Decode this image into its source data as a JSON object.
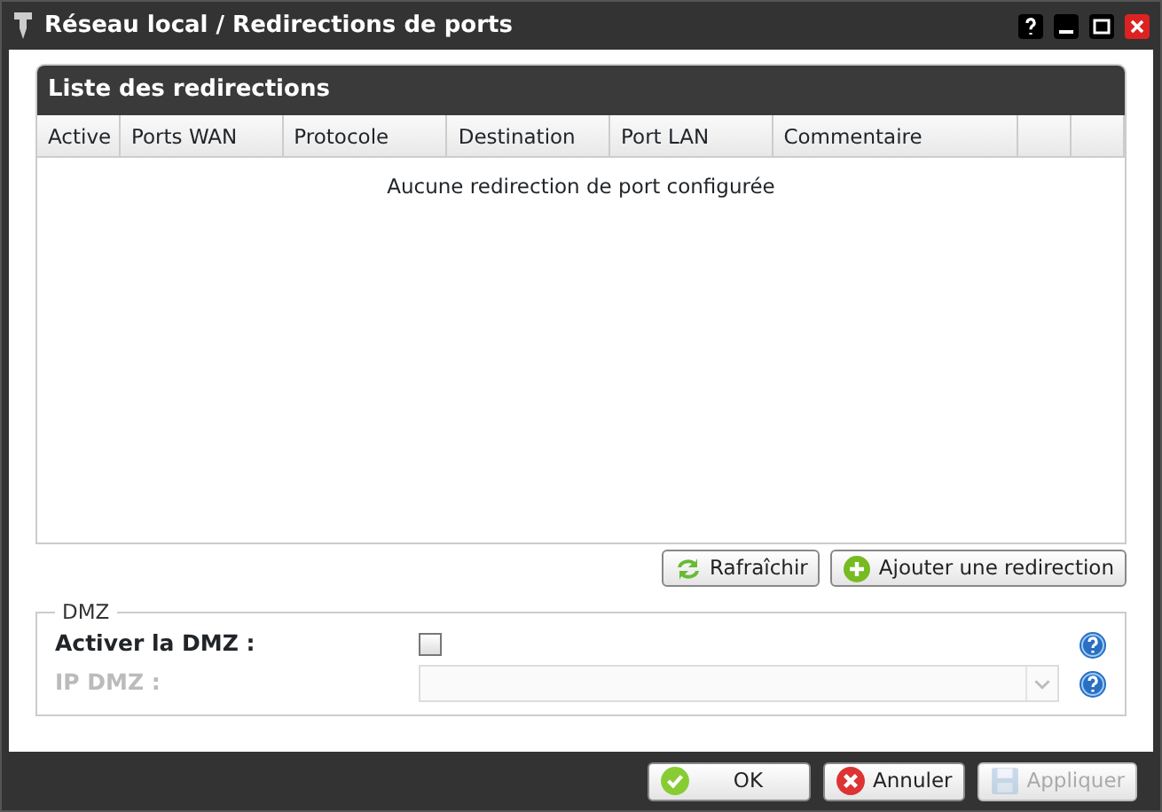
{
  "window": {
    "title": "Réseau local / Redirections de ports"
  },
  "panel": {
    "title": "Liste des redirections",
    "columns": [
      "Active",
      "Ports WAN",
      "Protocole",
      "Destination",
      "Port LAN",
      "Commentaire"
    ],
    "empty_message": "Aucune redirection de port configurée"
  },
  "panel_buttons": [
    {
      "kind": "refresh",
      "label": "Rafraîchir"
    },
    {
      "kind": "add",
      "label": "Ajouter une redirection"
    }
  ],
  "dmz": {
    "legend": "DMZ",
    "fields": [
      {
        "kind": "checkbox",
        "label": "Activer la DMZ :",
        "checked": false,
        "disabled": false
      },
      {
        "kind": "select",
        "label": "IP DMZ :",
        "disabled": true
      }
    ]
  },
  "footer_buttons": [
    {
      "kind": "ok",
      "label": "OK",
      "disabled": false
    },
    {
      "kind": "cancel",
      "label": "Annuler",
      "disabled": false
    },
    {
      "kind": "apply",
      "label": "Appliquer",
      "disabled": true
    }
  ]
}
